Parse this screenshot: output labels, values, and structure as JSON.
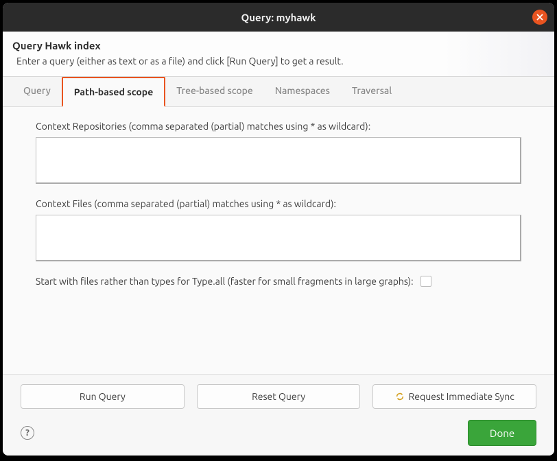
{
  "titlebar": {
    "title": "Query: myhawk"
  },
  "header": {
    "title": "Query Hawk index",
    "subtitle": "Enter a query (either as text or as a file) and click [Run Query] to get a result."
  },
  "tabs": [
    {
      "label": "Query",
      "active": false
    },
    {
      "label": "Path-based scope",
      "active": true
    },
    {
      "label": "Tree-based scope",
      "active": false
    },
    {
      "label": "Namespaces",
      "active": false
    },
    {
      "label": "Traversal",
      "active": false
    }
  ],
  "fields": {
    "context_repositories": {
      "label": "Context Repositories (comma separated (partial) matches using * as wildcard):",
      "value": ""
    },
    "context_files": {
      "label": "Context Files (comma separated (partial) matches using * as wildcard):",
      "value": ""
    },
    "start_with_files": {
      "label": "Start with files rather than types for Type.all (faster for small fragments in large graphs):",
      "checked": false
    }
  },
  "buttons": {
    "run_query": "Run Query",
    "reset_query": "Reset Query",
    "request_sync": "Request Immediate Sync",
    "done": "Done",
    "help": "?"
  }
}
